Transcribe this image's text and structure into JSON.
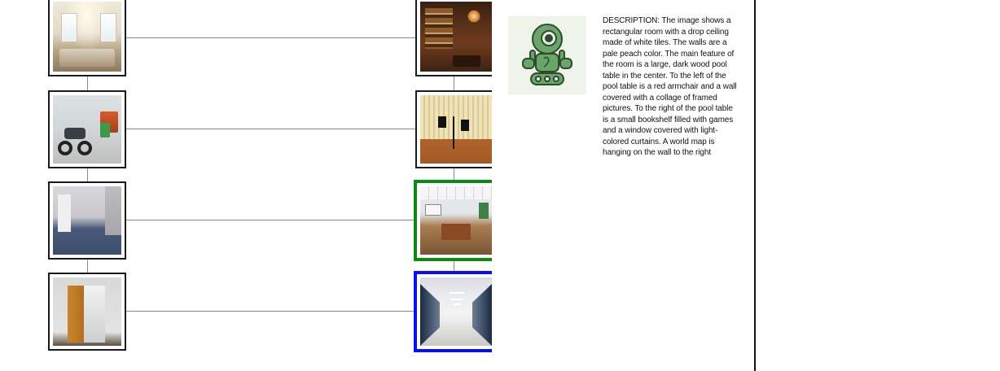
{
  "graph": {
    "left_column": [
      {
        "id": "living-room",
        "selected": null
      },
      {
        "id": "garage",
        "selected": null
      },
      {
        "id": "empty-room",
        "selected": null
      },
      {
        "id": "closet",
        "selected": null
      }
    ],
    "right_column": [
      {
        "id": "bar",
        "selected": null
      },
      {
        "id": "studio",
        "selected": null
      },
      {
        "id": "office",
        "selected": "green"
      },
      {
        "id": "hallway",
        "selected": "blue"
      }
    ]
  },
  "agent": {
    "avatar_icon": "robot-icon",
    "description": "DESCRIPTION: The image shows a rectangular room with a drop ceiling made of white tiles. The walls are a pale peach color. The main feature of the room is a large, dark wood pool table in the center. To the left of the pool table is a red armchair and a wall covered with a collage of framed pictures. To the right of the pool table is a small bookshelf filled with games and a window covered with light-colored curtains. A world map is hanging on the wall to the right"
  },
  "colors": {
    "selected_green": "#0a8a12",
    "selected_blue": "#0a10e8",
    "connector": "#8a8a8a",
    "robot_green": "#5a9a5a"
  }
}
